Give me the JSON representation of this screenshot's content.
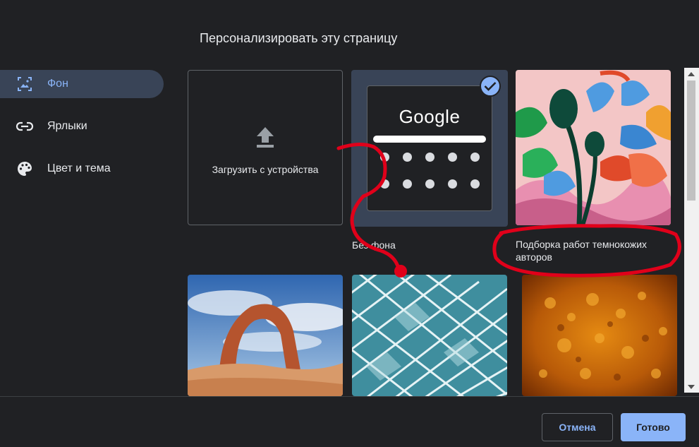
{
  "dialog": {
    "title": "Персонализировать эту страницу"
  },
  "sidebar": {
    "items": [
      {
        "label": "Фон",
        "icon": "image-icon",
        "active": true
      },
      {
        "label": "Ярлыки",
        "icon": "link-icon",
        "active": false
      },
      {
        "label": "Цвет и тема",
        "icon": "palette-icon",
        "active": false
      }
    ]
  },
  "tiles": {
    "upload_label": "Загрузить с устройства",
    "no_background_caption": "Без фона",
    "no_background_logo": "Google",
    "collection_caption": "Подборка работ темнокожих авторов"
  },
  "footer": {
    "cancel_label": "Отмена",
    "done_label": "Готово"
  },
  "colors": {
    "accent": "#8ab4f8",
    "background": "#202124",
    "selected_bg": "#394457",
    "annotation": "#e0001a"
  }
}
